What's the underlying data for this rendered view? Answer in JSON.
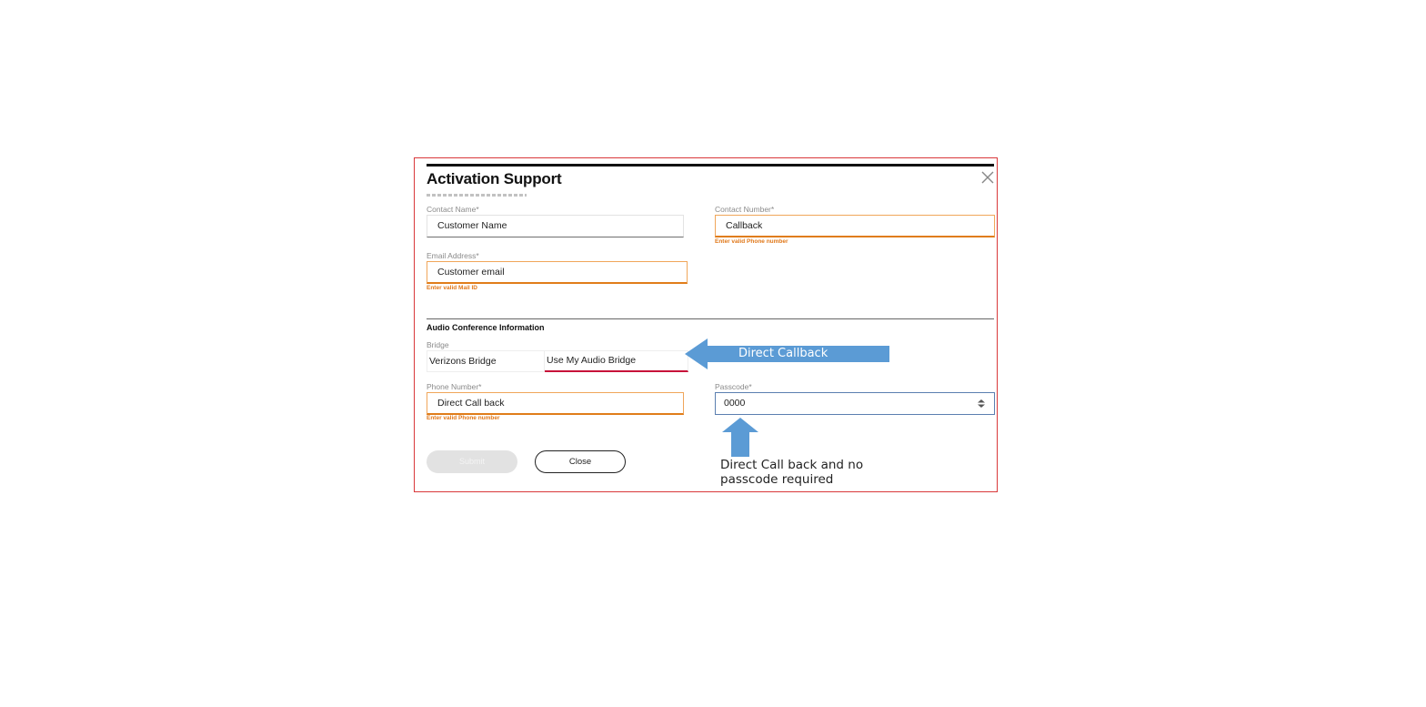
{
  "dialog": {
    "title": "Activation Support",
    "close_icon": "close-icon"
  },
  "contact": {
    "name_label": "Contact Name*",
    "name_value": "Customer Name",
    "number_label": "Contact Number*",
    "number_value": "Callback",
    "number_error": "Enter valid Phone number",
    "email_label": "Email Address*",
    "email_value": "Customer email",
    "email_error": "Enter valid Mail ID"
  },
  "audio": {
    "section_title": "Audio Conference Information",
    "bridge_label": "Bridge",
    "bridge_options": [
      "Verizons Bridge",
      "Use My Audio Bridge"
    ],
    "bridge_selected": "Use My Audio Bridge",
    "phone_label": "Phone Number*",
    "phone_value": "Direct Call back",
    "phone_error": "Enter valid Phone number",
    "passcode_label": "Passcode*",
    "passcode_value": "0000"
  },
  "buttons": {
    "submit_label": "Submit",
    "close_label": "Close"
  },
  "annotations": {
    "arrow_left_text": "Direct Callback",
    "note_line1": "Direct Call back and no",
    "note_line2": "passcode required",
    "arrow_color": "#5b9bd5"
  },
  "colors": {
    "frame_border": "#d9383a",
    "error": "#e0781a",
    "selected_underline": "#c7133a"
  }
}
